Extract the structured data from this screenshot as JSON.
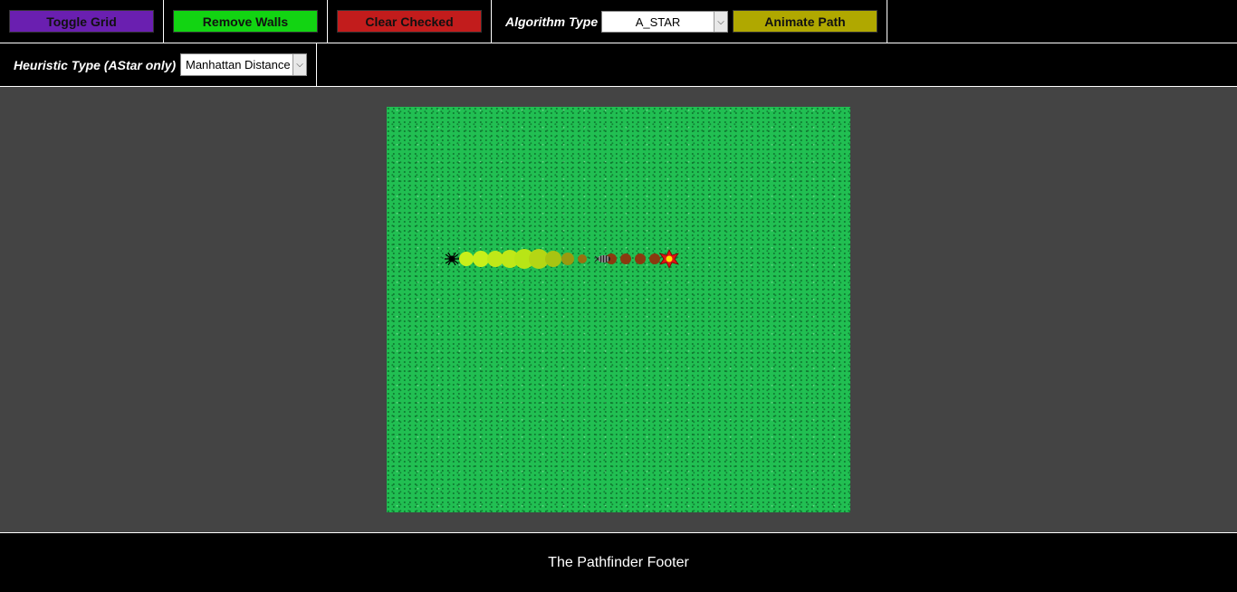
{
  "toolbar": {
    "toggle_grid": {
      "label": "Toggle Grid",
      "color": "#6a1fb0"
    },
    "remove_walls": {
      "label": "Remove Walls",
      "color": "#12d412"
    },
    "clear_checked": {
      "label": "Clear Checked",
      "color": "#c21c1c"
    },
    "algorithm_label": "Algorithm Type",
    "algorithm_value": "A_STAR",
    "animate_path": {
      "label": "Animate Path",
      "color": "#b0a800"
    }
  },
  "settings": {
    "heuristic_label": "Heuristic Type (AStar only)",
    "heuristic_value": "Manhattan Distance"
  },
  "board": {
    "grass_color": "#21bf52",
    "path_colors": [
      "#c8f01a",
      "#b4d614",
      "#9a8a10",
      "#8a3a10"
    ],
    "start_icon": "spider-icon",
    "end_icon": "flower-icon",
    "walker_icon": "bug-icon"
  },
  "footer": {
    "text": "The Pathfinder Footer"
  }
}
